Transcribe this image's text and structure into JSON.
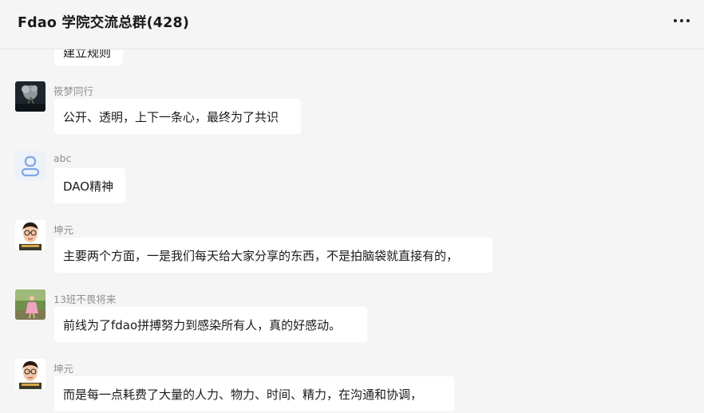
{
  "header": {
    "title": "Fdao 学院交流总群(428)",
    "more_icon": "more-horizontal-icon"
  },
  "messages": [
    {
      "sender": "",
      "text": "建立规则",
      "avatar": "none"
    },
    {
      "sender": "筱梦同行",
      "text": "公开、透明，上下一条心，最终为了共识",
      "avatar": "photo-dark-flower-icon"
    },
    {
      "sender": "abc",
      "text": "DAO精神",
      "avatar": "default-user-icon"
    },
    {
      "sender": "坤元",
      "text": "主要两个方面，一是我们每天给大家分享的东西，不是拍脑袋就直接有的，",
      "avatar": "cartoon-man-glasses-icon"
    },
    {
      "sender": "13班不畏将来",
      "text": "前线为了fdao拼搏努力到感染所有人，真的好感动。",
      "avatar": "photo-girl-pink-dress-icon"
    },
    {
      "sender": "坤元",
      "text": "而是每一点耗费了大量的人力、物力、时间、精力，在沟通和协调，",
      "avatar": "cartoon-man-glasses-icon"
    }
  ],
  "colors": {
    "background": "#f5f5f5",
    "bubble": "#ffffff",
    "sender_name": "#8f8f8f",
    "text": "#1a1a1a"
  }
}
